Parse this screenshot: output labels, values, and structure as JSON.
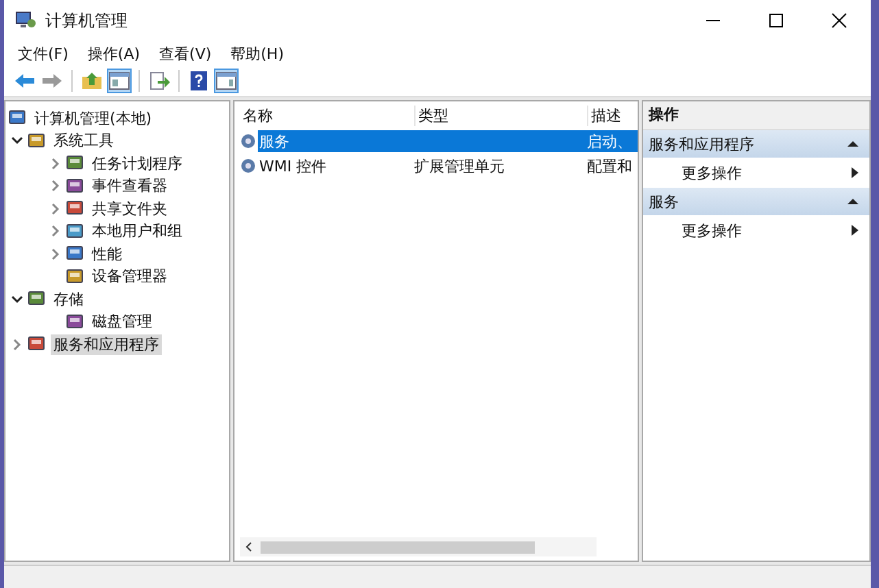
{
  "window": {
    "title": "计算机管理"
  },
  "menu": [
    "文件(F)",
    "操作(A)",
    "查看(V)",
    "帮助(H)"
  ],
  "toolbar": [
    {
      "kind": "back",
      "pressed": false
    },
    {
      "kind": "forward",
      "pressed": false
    },
    {
      "kind": "sep"
    },
    {
      "kind": "up",
      "pressed": false
    },
    {
      "kind": "tree",
      "pressed": true
    },
    {
      "kind": "sep"
    },
    {
      "kind": "export",
      "pressed": false
    },
    {
      "kind": "sep"
    },
    {
      "kind": "help",
      "pressed": false
    },
    {
      "kind": "pane",
      "pressed": true
    }
  ],
  "tree": [
    {
      "label": "计算机管理(本地)",
      "selected": false,
      "children": [
        {
          "label": "系统工具",
          "expanded": true,
          "selected": false,
          "children": [
            {
              "label": "任务计划程序",
              "expanded": false,
              "selected": false
            },
            {
              "label": "事件查看器",
              "expanded": false,
              "selected": false
            },
            {
              "label": "共享文件夹",
              "expanded": false,
              "selected": false
            },
            {
              "label": "本地用户和组",
              "expanded": false,
              "selected": false
            },
            {
              "label": "性能",
              "expanded": false,
              "selected": false
            },
            {
              "label": "设备管理器",
              "selected": false
            }
          ]
        },
        {
          "label": "存储",
          "expanded": true,
          "selected": false,
          "children": [
            {
              "label": "磁盘管理",
              "selected": false
            }
          ]
        },
        {
          "label": "服务和应用程序",
          "expanded": false,
          "selected": true
        }
      ]
    }
  ],
  "table": {
    "columns": [
      "名称",
      "类型",
      "描述"
    ],
    "rows": [
      {
        "cells": [
          "服务",
          "",
          "启动、"
        ],
        "selected": true
      },
      {
        "cells": [
          "WMI 控件",
          "扩展管理单元",
          "配置和"
        ],
        "selected": false
      }
    ]
  },
  "actions": {
    "title": "操作",
    "sections": [
      {
        "title": "服务和应用程序",
        "expanded": true,
        "items": [
          "更多操作"
        ]
      },
      {
        "title": "服务",
        "expanded": true,
        "items": [
          "更多操作"
        ]
      }
    ]
  }
}
